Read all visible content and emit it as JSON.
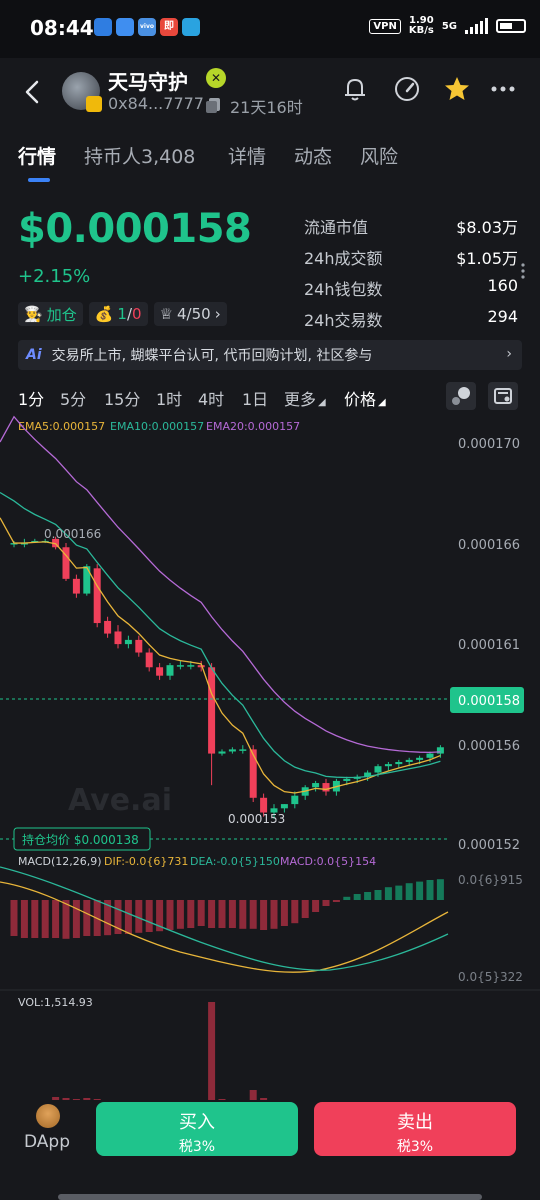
{
  "status": {
    "time": "08:44",
    "vpn": "VPN",
    "speed_value": "1.90",
    "speed_unit": "KB/s",
    "network": "5G",
    "apps": [
      "a",
      "b",
      "vivo",
      "即",
      "t"
    ]
  },
  "header": {
    "name": "天马守护",
    "address": "0x84...7777",
    "age": "21天16时"
  },
  "tabs": [
    "行情",
    "持币人3,408",
    "详情",
    "动态",
    "风险"
  ],
  "price": {
    "value": "$0.000158",
    "change": "+2.15%",
    "tag_add": "加仓",
    "tag_ratio_a": "1",
    "tag_ratio_sep": "/",
    "tag_ratio_b": "0",
    "tag_rank": "4/50"
  },
  "stats": [
    {
      "k": "流通市值",
      "v": "$8.03万"
    },
    {
      "k": "24h成交额",
      "v": "$1.05万"
    },
    {
      "k": "24h钱包数",
      "v": "160"
    },
    {
      "k": "24h交易数",
      "v": "294"
    }
  ],
  "ai_banner": {
    "badge": "Ai",
    "text": "交易所上市, 蝴蝶平台认可, 代币回购计划, 社区参与"
  },
  "intervals": [
    "1分",
    "5分",
    "15分",
    "1时",
    "4时",
    "1日",
    "更多",
    "价格"
  ],
  "chart_data": {
    "type": "candlestick",
    "ema_labels": [
      "EMA5:0.000157",
      "EMA10:0.000157",
      "EMA20:0.000157"
    ],
    "price_axis": [
      "0.000170",
      "0.000166",
      "0.000161",
      "0.000156",
      "0.000152"
    ],
    "current_price_tag": "0.000158",
    "high_label": "0.000166",
    "low_label": "0.000153",
    "cost_label": "持仓均价 $0.000138",
    "watermark": "Ave.ai",
    "candles": [
      [
        0.0001662,
        0.0001663,
        0.0001662,
        0.000166
      ],
      [
        0.0001662,
        0.0001664,
        0.0001662,
        0.000166
      ],
      [
        0.0001663,
        0.0001664,
        0.0001663,
        0.0001662
      ],
      [
        0.0001663,
        0.0001664,
        0.0001663,
        0.0001662
      ],
      [
        0.0001664,
        0.0001665,
        0.000166,
        0.0001659
      ],
      [
        0.000166,
        0.0001662,
        0.0001645,
        0.0001644
      ],
      [
        0.0001645,
        0.0001647,
        0.0001638,
        0.0001636
      ],
      [
        0.0001638,
        0.0001652,
        0.0001651,
        0.0001637
      ],
      [
        0.000165,
        0.0001652,
        0.0001624,
        0.0001622
      ],
      [
        0.0001625,
        0.0001627,
        0.0001619,
        0.0001617
      ],
      [
        0.000162,
        0.0001623,
        0.0001614,
        0.0001612
      ],
      [
        0.0001614,
        0.0001618,
        0.0001616,
        0.0001612
      ],
      [
        0.0001616,
        0.0001618,
        0.000161,
        0.0001608
      ],
      [
        0.000161,
        0.0001612,
        0.0001603,
        0.0001601
      ],
      [
        0.0001603,
        0.0001605,
        0.0001599,
        0.0001597
      ],
      [
        0.0001599,
        0.0001605,
        0.0001604,
        0.0001597
      ],
      [
        0.0001604,
        0.0001606,
        0.0001604,
        0.0001602
      ],
      [
        0.0001604,
        0.0001606,
        0.0001604,
        0.0001602
      ],
      [
        0.0001604,
        0.0001606,
        0.0001603,
        0.0001601
      ],
      [
        0.0001603,
        0.0001605,
        0.0001562,
        0.0001547
      ],
      [
        0.0001562,
        0.0001564,
        0.0001563,
        0.0001561
      ],
      [
        0.0001563,
        0.0001565,
        0.0001564,
        0.0001562
      ],
      [
        0.0001564,
        0.0001566,
        0.0001564,
        0.0001562
      ],
      [
        0.0001564,
        0.0001566,
        0.0001541,
        0.0001539
      ],
      [
        0.0001541,
        0.0001543,
        0.0001534,
        0.0001532
      ],
      [
        0.0001534,
        0.0001538,
        0.0001536,
        0.0001531
      ],
      [
        0.0001536,
        0.0001538,
        0.0001538,
        0.0001534
      ],
      [
        0.0001538,
        0.0001544,
        0.0001542,
        0.0001536
      ],
      [
        0.0001542,
        0.0001547,
        0.0001546,
        0.000154
      ],
      [
        0.0001546,
        0.0001549,
        0.0001548,
        0.0001544
      ],
      [
        0.0001548,
        0.000155,
        0.0001544,
        0.0001542
      ],
      [
        0.0001544,
        0.000155,
        0.0001549,
        0.0001542
      ],
      [
        0.0001549,
        0.0001551,
        0.000155,
        0.0001547
      ],
      [
        0.000155,
        0.0001552,
        0.0001551,
        0.0001548
      ],
      [
        0.0001551,
        0.0001554,
        0.0001553,
        0.0001549
      ],
      [
        0.0001553,
        0.0001557,
        0.0001556,
        0.0001551
      ],
      [
        0.0001556,
        0.0001558,
        0.0001557,
        0.0001554
      ],
      [
        0.0001557,
        0.0001559,
        0.0001558,
        0.0001555
      ],
      [
        0.0001558,
        0.000156,
        0.0001559,
        0.0001556
      ],
      [
        0.0001559,
        0.0001561,
        0.000156,
        0.0001557
      ],
      [
        0.000156,
        0.0001563,
        0.0001562,
        0.0001558
      ],
      [
        0.0001562,
        0.0001566,
        0.0001565,
        0.000156
      ]
    ],
    "macd_labels": [
      "MACD(12,26,9)",
      "DIF:-0.0{6}731",
      "DEA:-0.0{5}150",
      "MACD:0.0{5}154"
    ],
    "macd_axis": [
      "0.0{6}915",
      "0.0{5}322"
    ],
    "macd_hist": [
      -0.9,
      -0.95,
      -0.95,
      -0.95,
      -0.95,
      -0.97,
      -0.95,
      -0.9,
      -0.9,
      -0.88,
      -0.85,
      -0.85,
      -0.82,
      -0.8,
      -0.78,
      -0.75,
      -0.72,
      -0.7,
      -0.65,
      -0.7,
      -0.7,
      -0.7,
      -0.72,
      -0.72,
      -0.75,
      -0.72,
      -0.65,
      -0.58,
      -0.45,
      -0.3,
      -0.15,
      -0.05,
      0.08,
      0.15,
      0.2,
      0.25,
      0.32,
      0.36,
      0.42,
      0.46,
      0.5,
      0.52
    ],
    "vol_label": "VOL:1,514.93",
    "volumes": [
      0.02,
      0.02,
      0.02,
      0.02,
      0.05,
      0.04,
      0.03,
      0.04,
      0.03,
      0.02,
      0.02,
      0.02,
      0.02,
      0.02,
      0.02,
      0.02,
      0.02,
      0.02,
      0.02,
      1.0,
      0.03,
      0.02,
      0.02,
      0.12,
      0.04,
      0.02,
      0.02,
      0.02,
      0.02,
      0.02,
      0.02,
      0.02,
      0.02,
      0.02,
      0.02,
      0.02,
      0.02,
      0.02,
      0.02,
      0.02,
      0.02,
      0.02
    ],
    "colors": {
      "up": "#1fc48c",
      "down": "#f0405a",
      "ema5": "#e8b53a",
      "ema10": "#2bb89a",
      "ema20": "#b56ad6"
    }
  },
  "bottom": {
    "dapp": "DApp",
    "buy": "买入",
    "buy_tax": "税3%",
    "sell": "卖出",
    "sell_tax": "税3%"
  }
}
